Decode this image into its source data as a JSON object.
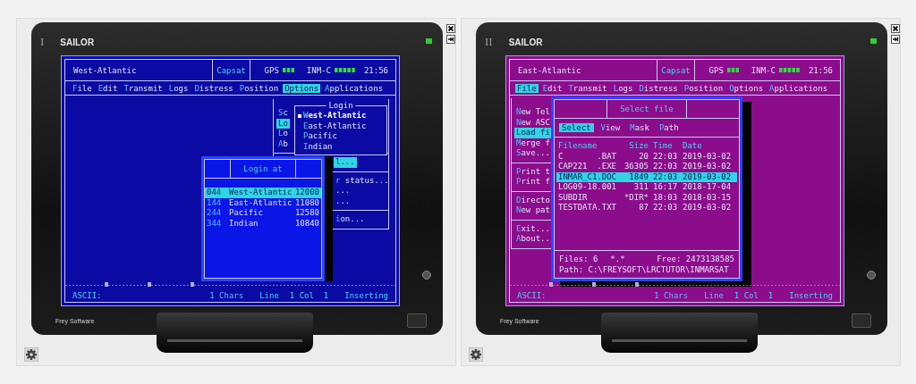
{
  "panels": [
    {
      "numeral": "I",
      "color": "#0b0ba4",
      "brand": "SAILOR",
      "maker": "Frey Software",
      "status": {
        "location": "West-Atlantic",
        "provider": "Capsat",
        "gps": "GPS",
        "inm": "INM-C",
        "time": "21:56"
      },
      "menu": [
        {
          "label": "File",
          "selected": false
        },
        {
          "label": "Edit",
          "selected": false
        },
        {
          "label": "Transmit",
          "selected": false
        },
        {
          "label": "Logs",
          "selected": false
        },
        {
          "label": "Distress",
          "selected": false
        },
        {
          "label": "Position",
          "selected": false
        },
        {
          "label": "Options",
          "selected": true
        },
        {
          "label": "Applications",
          "selected": false
        }
      ],
      "overlays": [
        {
          "kind": "menu",
          "groups": [
            {
              "items": [
                {
                  "label": "Sc",
                  "selected": false
                },
                {
                  "label": "Lo",
                  "selected": true
                },
                {
                  "label": "Lo",
                  "selected": false
                },
                {
                  "label": "Ab",
                  "selected": false
                }
              ]
            },
            {
              "items": [
                {
                  "label": "l...",
                  "selected": true
                }
              ]
            },
            {
              "items": [
                {
                  "label": "r status...",
                  "selected": false
                },
                {
                  "label": "...",
                  "selected": false
                },
                {
                  "label": "...",
                  "selected": false
                }
              ]
            },
            {
              "items": [
                {
                  "label": "ion...",
                  "selected": false
                }
              ]
            }
          ]
        },
        {
          "kind": "submenu",
          "title": "Login",
          "items": [
            {
              "label": "West-Atlantic",
              "selected": true
            },
            {
              "label": "East-Atlantic",
              "selected": false
            },
            {
              "label": "Pacific",
              "selected": false
            },
            {
              "label": "Indian",
              "selected": false
            }
          ]
        },
        {
          "kind": "list-dialog",
          "title": "Login at",
          "color": "#0a16e6",
          "rows": [
            {
              "code": "044",
              "name": "West-Atlantic",
              "freq": "12000",
              "selected": true
            },
            {
              "code": "144",
              "name": "East-Atlantic",
              "freq": "11080",
              "selected": false
            },
            {
              "code": "244",
              "name": "Pacific",
              "freq": "12580",
              "selected": false
            },
            {
              "code": "344",
              "name": "Indian",
              "freq": "10840",
              "selected": false
            }
          ]
        }
      ],
      "statusline": {
        "mode": "ASCII:",
        "chars": "1 Chars",
        "line": "Line",
        "col": "1 Col  1",
        "insert": "Inserting"
      }
    },
    {
      "numeral": "II",
      "color": "#8c0d8c",
      "brand": "SAILOR",
      "maker": "Frey Software",
      "status": {
        "location": "East-Atlantic",
        "provider": "Capsat",
        "gps": "GPS",
        "inm": "INM-C",
        "time": "21:56"
      },
      "menu": [
        {
          "label": "File",
          "selected": true
        },
        {
          "label": "Edit",
          "selected": false
        },
        {
          "label": "Transmit",
          "selected": false
        },
        {
          "label": "Logs",
          "selected": false
        },
        {
          "label": "Distress",
          "selected": false
        },
        {
          "label": "Position",
          "selected": false
        },
        {
          "label": "Options",
          "selected": false
        },
        {
          "label": "Applications",
          "selected": false
        }
      ],
      "overlays": [
        {
          "kind": "menu",
          "groups": [
            {
              "items": [
                {
                  "label": "New Tel",
                  "selected": false
                },
                {
                  "label": "New ASC",
                  "selected": false
                },
                {
                  "label": "Load fi",
                  "selected": true
                },
                {
                  "label": "Merge f",
                  "selected": false
                },
                {
                  "label": "Save...",
                  "selected": false
                }
              ]
            },
            {
              "items": [
                {
                  "label": "Print t",
                  "selected": false
                },
                {
                  "label": "Print f",
                  "selected": false
                }
              ]
            },
            {
              "items": [
                {
                  "label": "Directo",
                  "selected": false
                },
                {
                  "label": "New pat",
                  "selected": false
                }
              ]
            },
            {
              "items": [
                {
                  "label": "Exit...",
                  "selected": false
                },
                {
                  "label": "About..",
                  "selected": false
                }
              ]
            }
          ]
        },
        {
          "kind": "file-dialog",
          "title": "Select file",
          "color": "#8c0d8c",
          "tabs": [
            {
              "label": "Select",
              "selected": true
            },
            {
              "label": "View",
              "selected": false
            },
            {
              "label": "Mask",
              "selected": false
            },
            {
              "label": "Path",
              "selected": false
            }
          ],
          "columns": [
            "Filename",
            "Size",
            "Time",
            "Date"
          ],
          "rows": [
            {
              "name": "C       .BAT",
              "size": "20",
              "time": "22:03",
              "date": "2019-03-02",
              "selected": false
            },
            {
              "name": "CAP221  .EXE",
              "size": "36305",
              "time": "22:03",
              "date": "2019-03-02",
              "selected": false
            },
            {
              "name": "INMAR_C1.DOC",
              "size": "1849",
              "time": "22:03",
              "date": "2019-03-02",
              "selected": true
            },
            {
              "name": "LOG09-18.001",
              "size": "311",
              "time": "16:17",
              "date": "2018-17-04",
              "selected": false
            },
            {
              "name": "SUBDIR",
              "size": "*DIR*",
              "time": "18:03",
              "date": "2018-03-15",
              "selected": false
            },
            {
              "name": "TESTDATA.TXT",
              "size": "87",
              "time": "22:03",
              "date": "2019-03-02",
              "selected": false
            }
          ],
          "files": "Files: 6",
          "mask": "*.*",
          "free": "Free: 2473138585",
          "path": "Path: C:\\FREYSOFT\\LRCTUTOR\\INMARSAT"
        }
      ],
      "statusline": {
        "mode": "ASCII:",
        "chars": "1 Chars",
        "line": "Line",
        "col": "1 Col  1",
        "insert": "Inserting"
      }
    }
  ]
}
